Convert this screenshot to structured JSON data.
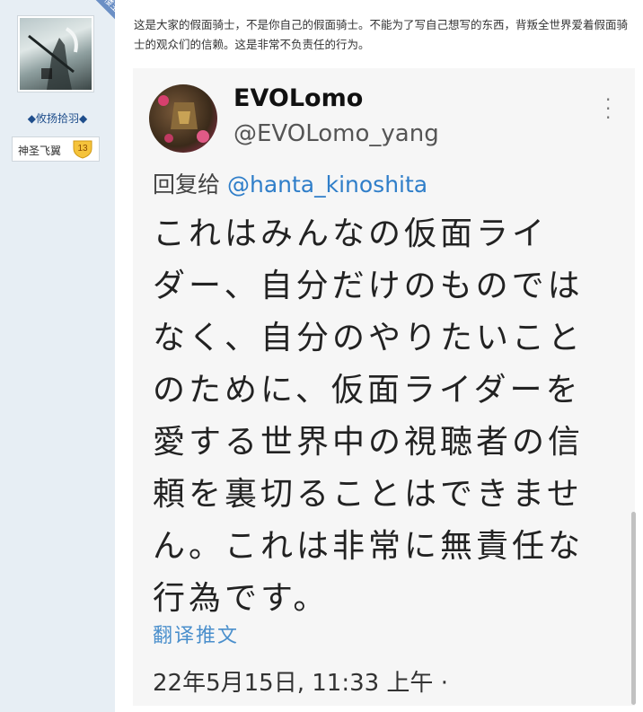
{
  "sidebar": {
    "corner_tag": "楼主",
    "username": "◆攸扬拾羽◆",
    "badge": {
      "title": "神圣飞翼",
      "level": "13"
    }
  },
  "post": {
    "text": "这是大家的假面骑士，不是你自己的假面骑士。不能为了写自己想写的东西，背叛全世界爱着假面骑士的观众们的信赖。这是非常不负责任的行为。"
  },
  "tweet": {
    "display_name": "EVOLomo",
    "handle": "@EVOLomo_yang",
    "reply_prefix": "回复给",
    "reply_to": "@hanta_kinoshita",
    "lines": [
      "これはみんなの仮面ライ",
      "ダー、自分だけのものでは",
      "なく、自分のやりたいこと",
      "のために、仮面ライダーを",
      "愛する世界中の視聴者の信",
      "頼を裏切ることはできませ",
      "ん。これは非常に無責任な",
      "行為です。"
    ],
    "translate_label": "翻译推文",
    "timestamp": "22年5月15日, 11:33 上午 ·"
  },
  "colors": {
    "sidebar_bg": "#e7eef4",
    "link": "#2f7ec9",
    "corner_tag_bg": "#6b8fc5"
  }
}
